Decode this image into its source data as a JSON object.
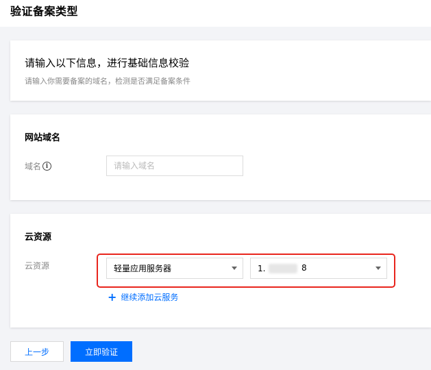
{
  "page": {
    "title": "验证备案类型"
  },
  "intro": {
    "title": "请输入以下信息，进行基础信息校验",
    "description": "请输入你需要备案的域名，检测是否满足备案条件"
  },
  "domain_section": {
    "title": "网站域名",
    "field_label": "域名",
    "info_icon": "info-icon",
    "input_value": "",
    "input_placeholder": "请输入域名"
  },
  "cloud_section": {
    "title": "云资源",
    "field_label": "云资源",
    "product_select_value": "轻量应用服务器",
    "instance_select_prefix": "1.",
    "instance_select_suffix": "8",
    "add_link_label": "继续添加云服务",
    "add_icon": "plus-icon",
    "highlight_color": "#e8241c"
  },
  "actions": {
    "prev_label": "上一步",
    "submit_label": "立即验证"
  },
  "colors": {
    "accent": "#006eff",
    "page_background": "#f3f4f7"
  }
}
